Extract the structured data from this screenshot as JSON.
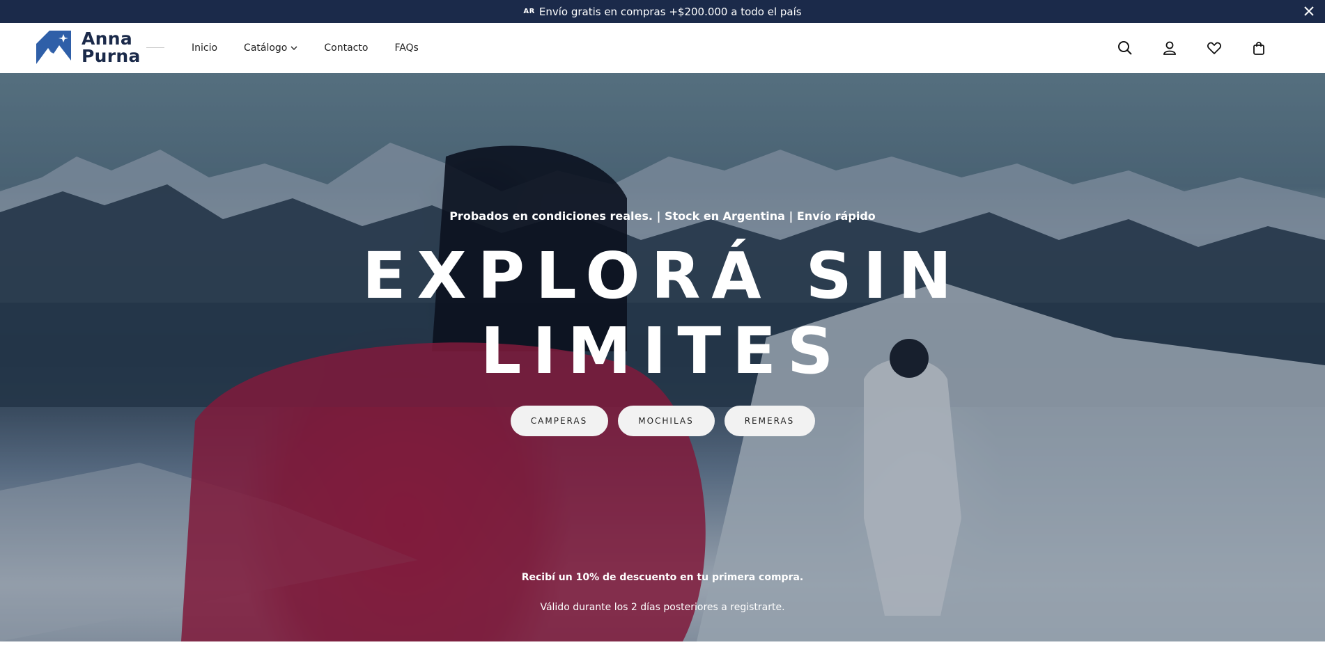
{
  "announcement": {
    "flag": "AR",
    "text": "Envío gratis en compras +$200.000 a todo el país"
  },
  "brand": {
    "name_line1": "Anna",
    "name_line2": "Purna"
  },
  "nav": {
    "items": [
      {
        "label": "Inicio"
      },
      {
        "label": "Catálogo"
      },
      {
        "label": "Contacto"
      },
      {
        "label": "FAQs"
      }
    ]
  },
  "hero": {
    "tagline": "Probados en condiciones reales. | Stock en Argentina | Envío rápido",
    "headline_line1": "EXPLORÁ SIN",
    "headline_line2": "LIMITES",
    "buttons": [
      {
        "label": "CAMPERAS"
      },
      {
        "label": "MOCHILAS"
      },
      {
        "label": "REMERAS"
      }
    ],
    "promo_title": "Recibí un 10% de descuento en tu primera compra.",
    "promo_subtitle": "Válido durante los 2 días posteriores a registrarte."
  },
  "icons": {
    "close": "close-icon",
    "search": "search-icon",
    "account": "user-icon",
    "wishlist": "heart-icon",
    "cart": "shopping-bag-icon",
    "chevron": "chevron-down-icon"
  },
  "colors": {
    "announcement_bg": "#1b2a4a",
    "brand": "#1b2a4a",
    "logo_blue": "#2f5fa8",
    "button_bg": "#f2f2f2"
  }
}
